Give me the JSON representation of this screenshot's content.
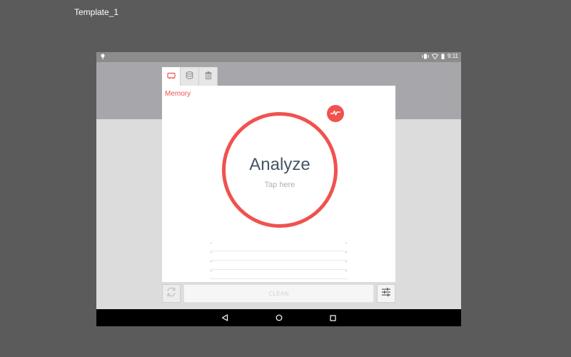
{
  "page": {
    "title": "Template_1"
  },
  "status_bar": {
    "time": "9:11"
  },
  "tabs": [
    {
      "name": "memory",
      "icon": "memory-icon",
      "active": true
    },
    {
      "name": "storage",
      "icon": "database-icon",
      "active": false
    },
    {
      "name": "trash",
      "icon": "trash-icon",
      "active": false
    }
  ],
  "card": {
    "title": "Memory"
  },
  "analyze": {
    "label": "Analyze",
    "hint": "Tap here"
  },
  "actions": {
    "clean_label": "CLEAN"
  },
  "colors": {
    "accent": "#f0524f",
    "text_dark": "#455564",
    "background": "#5b5b5b"
  },
  "icons": {
    "fab": "pulse-icon",
    "refresh": "refresh-icon",
    "settings": "sliders-icon",
    "nav": [
      "back-icon",
      "home-icon",
      "recents-icon"
    ]
  }
}
